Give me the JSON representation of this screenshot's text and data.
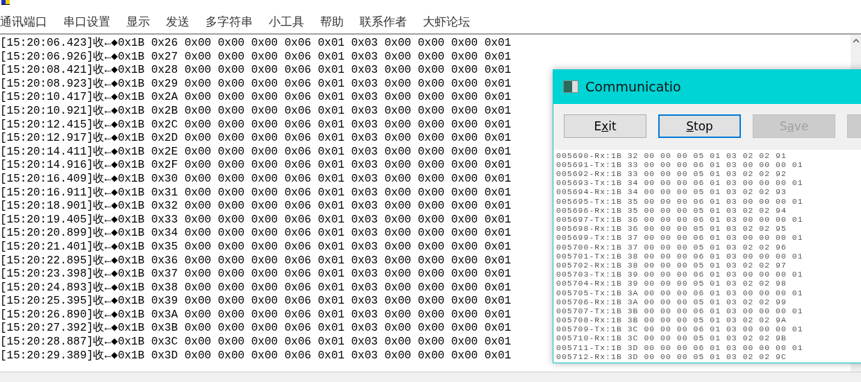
{
  "menu": [
    "通讯端口",
    "串口设置",
    "显示",
    "发送",
    "多字符串",
    "小工具",
    "帮助",
    "联系作者",
    "大虾论坛"
  ],
  "log": {
    "rows": [
      "[15:20:06.423]收←◆0x1B 0x26 0x00 0x00 0x00 0x06 0x01 0x03 0x00 0x00 0x00 0x01",
      "[15:20:06.926]收←◆0x1B 0x27 0x00 0x00 0x00 0x06 0x01 0x03 0x00 0x00 0x00 0x01",
      "[15:20:08.421]收←◆0x1B 0x28 0x00 0x00 0x00 0x06 0x01 0x03 0x00 0x00 0x00 0x01",
      "[15:20:08.923]收←◆0x1B 0x29 0x00 0x00 0x00 0x06 0x01 0x03 0x00 0x00 0x00 0x01",
      "[15:20:10.417]收←◆0x1B 0x2A 0x00 0x00 0x00 0x06 0x01 0x03 0x00 0x00 0x00 0x01",
      "[15:20:10.921]收←◆0x1B 0x2B 0x00 0x00 0x00 0x06 0x01 0x03 0x00 0x00 0x00 0x01",
      "[15:20:12.415]收←◆0x1B 0x2C 0x00 0x00 0x00 0x06 0x01 0x03 0x00 0x00 0x00 0x01",
      "[15:20:12.917]收←◆0x1B 0x2D 0x00 0x00 0x00 0x06 0x01 0x03 0x00 0x00 0x00 0x01",
      "[15:20:14.411]收←◆0x1B 0x2E 0x00 0x00 0x00 0x06 0x01 0x03 0x00 0x00 0x00 0x01",
      "[15:20:14.916]收←◆0x1B 0x2F 0x00 0x00 0x00 0x06 0x01 0x03 0x00 0x00 0x00 0x01",
      "[15:20:16.409]收←◆0x1B 0x30 0x00 0x00 0x00 0x06 0x01 0x03 0x00 0x00 0x00 0x01",
      "[15:20:16.911]收←◆0x1B 0x31 0x00 0x00 0x00 0x06 0x01 0x03 0x00 0x00 0x00 0x01",
      "[15:20:18.901]收←◆0x1B 0x32 0x00 0x00 0x00 0x06 0x01 0x03 0x00 0x00 0x00 0x01",
      "[15:20:19.405]收←◆0x1B 0x33 0x00 0x00 0x00 0x06 0x01 0x03 0x00 0x00 0x00 0x01",
      "[15:20:20.899]收←◆0x1B 0x34 0x00 0x00 0x00 0x06 0x01 0x03 0x00 0x00 0x00 0x01",
      "[15:20:21.401]收←◆0x1B 0x35 0x00 0x00 0x00 0x06 0x01 0x03 0x00 0x00 0x00 0x01",
      "[15:20:22.895]收←◆0x1B 0x36 0x00 0x00 0x00 0x06 0x01 0x03 0x00 0x00 0x00 0x01",
      "[15:20:23.398]收←◆0x1B 0x37 0x00 0x00 0x00 0x06 0x01 0x03 0x00 0x00 0x00 0x01",
      "[15:20:24.893]收←◆0x1B 0x38 0x00 0x00 0x00 0x06 0x01 0x03 0x00 0x00 0x00 0x01",
      "[15:20:25.395]收←◆0x1B 0x39 0x00 0x00 0x00 0x06 0x01 0x03 0x00 0x00 0x00 0x01",
      "[15:20:26.890]收←◆0x1B 0x3A 0x00 0x00 0x00 0x06 0x01 0x03 0x00 0x00 0x00 0x01",
      "[15:20:27.392]收←◆0x1B 0x3B 0x00 0x00 0x00 0x06 0x01 0x03 0x00 0x00 0x00 0x01",
      "[15:20:28.887]收←◆0x1B 0x3C 0x00 0x00 0x00 0x06 0x01 0x03 0x00 0x00 0x00 0x01",
      "[15:20:29.389]收←◆0x1B 0x3D 0x00 0x00 0x00 0x06 0x01 0x03 0x00 0x00 0x00 0x01"
    ]
  },
  "dialog": {
    "title": "Communicatio",
    "buttons": [
      {
        "before": "E",
        "access_key": "x",
        "after": "it",
        "focused": false,
        "disabled": false
      },
      {
        "access_key": "S",
        "after": "top",
        "focused": true,
        "disabled": false
      },
      {
        "before": "S",
        "access_key": "a",
        "after": "ve",
        "focused": false,
        "disabled": true
      },
      {
        "focused": false,
        "disabled": true
      }
    ],
    "log": [
      "005690-Rx:1B 32 00 00 00 05 01 03 02 02 91",
      "005691-Tx:1B 33 00 00 00 06 01 03 00 00 00 01",
      "005692-Rx:1B 33 00 00 00 05 01 03 02 02 92",
      "005693-Tx:1B 34 00 00 00 06 01 03 00 00 00 01",
      "005694-Rx:1B 34 00 00 00 05 01 03 02 02 93",
      "005695-Tx:1B 35 00 00 00 06 01 03 00 00 00 01",
      "005696-Rx:1B 35 00 00 00 05 01 03 02 02 94",
      "005697-Tx:1B 36 00 00 00 06 01 03 00 00 00 01",
      "005698-Rx:1B 36 00 00 00 05 01 03 02 02 95",
      "005699-Tx:1B 37 00 00 00 06 01 03 00 00 00 01",
      "005700-Rx:1B 37 00 00 00 05 01 03 02 02 96",
      "005701-Tx:1B 38 00 00 00 06 01 03 00 00 00 01",
      "005702-Rx:1B 38 00 00 00 05 01 03 02 02 97",
      "005703-Tx:1B 39 00 00 00 06 01 03 00 00 00 01",
      "005704-Rx:1B 39 00 00 00 05 01 03 02 02 98",
      "005705-Tx:1B 3A 00 00 00 06 01 03 00 00 00 01",
      "005706-Rx:1B 3A 00 00 00 05 01 03 02 02 99",
      "005707-Tx:1B 3B 00 00 00 06 01 03 00 00 00 01",
      "005708-Rx:1B 3B 00 00 00 05 01 03 02 02 9A",
      "005709-Tx:1B 3C 00 00 00 06 01 03 00 00 00 01",
      "005710-Rx:1B 3C 00 00 00 05 01 03 02 02 9B",
      "005711-Tx:1B 3D 00 00 00 06 01 03 00 00 00 01",
      "005712-Rx:1B 3D 00 00 00 05 01 03 02 02 9C"
    ]
  }
}
